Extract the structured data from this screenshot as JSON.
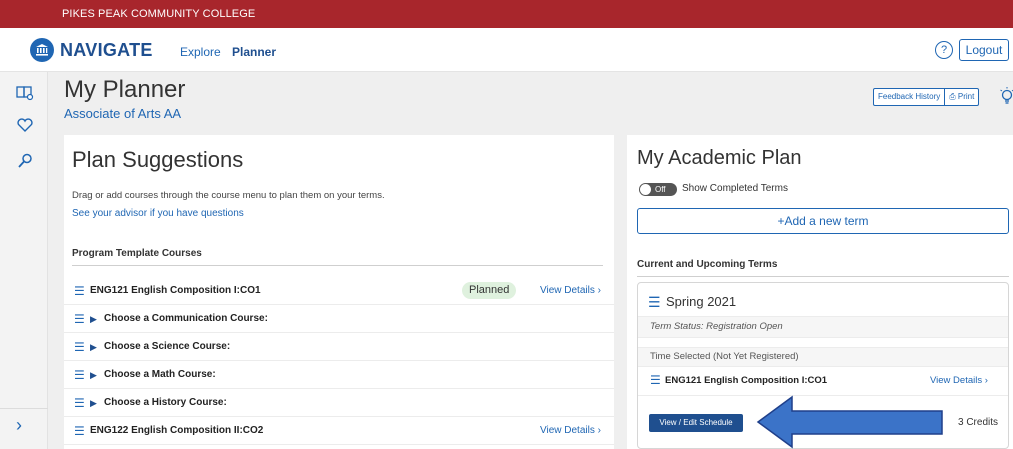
{
  "header": {
    "school_name": "PIKES PEAK COMMUNITY COLLEGE"
  },
  "nav": {
    "app_name": "NAVIGATE",
    "explore_label": "Explore",
    "planner_label": "Planner",
    "help_glyph": "?",
    "logout_label": "Logout"
  },
  "rail": {
    "icons": [
      "catalog-icon",
      "heart-icon",
      "search-icon"
    ],
    "expand_glyph": "›"
  },
  "page": {
    "title": "My Planner",
    "subtitle": "Associate of Arts AA",
    "feedback_label": "Feedback History",
    "print_label": "Print"
  },
  "suggestions": {
    "title": "Plan Suggestions",
    "description": "Drag or add courses through the course menu to plan them on your terms.",
    "advisor_link": "See your advisor if you have questions",
    "section_title": "Program Template Courses",
    "courses": [
      {
        "label": "ENG121 English Composition I:CO1",
        "status": "Planned",
        "details": "View Details ›",
        "group": false
      },
      {
        "label": "Choose a Communication Course:",
        "status": "",
        "details": "",
        "group": true
      },
      {
        "label": "Choose a Science Course:",
        "status": "",
        "details": "",
        "group": true
      },
      {
        "label": "Choose a Math Course:",
        "status": "",
        "details": "",
        "group": true
      },
      {
        "label": "Choose a History Course:",
        "status": "",
        "details": "",
        "group": true
      },
      {
        "label": "ENG122 English Composition II:CO2",
        "status": "",
        "details": "View Details ›",
        "group": false
      }
    ]
  },
  "plan": {
    "title": "My Academic Plan",
    "toggle_state": "Off",
    "toggle_label": "Show Completed Terms",
    "add_term_label": "+Add a new term",
    "section_title": "Current and Upcoming Terms",
    "term": {
      "name": "Spring 2021",
      "status": "Term Status: Registration Open",
      "time_selected": "Time Selected (Not Yet Registered)",
      "course": "ENG121 English Composition I:CO1",
      "course_details": "View Details ›",
      "schedule_button": "View / Edit Schedule",
      "credits": "3 Credits"
    }
  },
  "colors": {
    "brand_red": "#a8262c",
    "link_blue": "#1f66b3",
    "navy": "#1f4f8f",
    "planned_green": "#dff1de",
    "annotation_arrow": "#3b73c8"
  }
}
